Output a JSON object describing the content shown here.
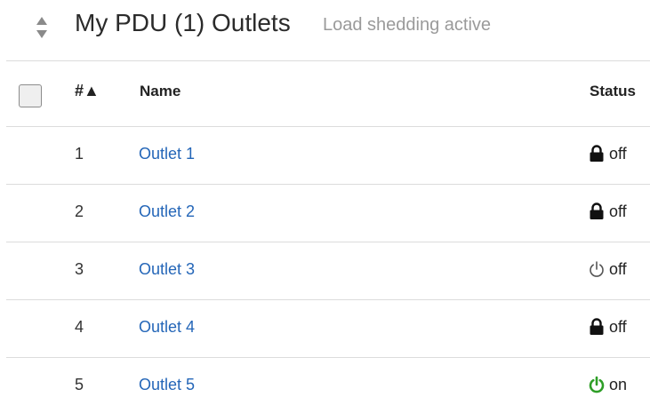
{
  "header": {
    "title": "My PDU (1) Outlets",
    "subtitle": "Load shedding active",
    "sort_icon": "sort-updown-icon"
  },
  "table": {
    "columns": {
      "number": "#▲",
      "name": "Name",
      "status": "Status"
    },
    "rows": [
      {
        "number": "1",
        "name": "Outlet 1",
        "status": "off",
        "icon": "lock-icon"
      },
      {
        "number": "2",
        "name": "Outlet 2",
        "status": "off",
        "icon": "lock-icon"
      },
      {
        "number": "3",
        "name": "Outlet 3",
        "status": "off",
        "icon": "power-icon"
      },
      {
        "number": "4",
        "name": "Outlet 4",
        "status": "off",
        "icon": "lock-icon"
      },
      {
        "number": "5",
        "name": "Outlet 5",
        "status": "on",
        "icon": "power-icon"
      }
    ]
  },
  "colors": {
    "link": "#2466b8",
    "power_on": "#2e9e27",
    "power_off": "#555555",
    "lock": "#111111"
  }
}
